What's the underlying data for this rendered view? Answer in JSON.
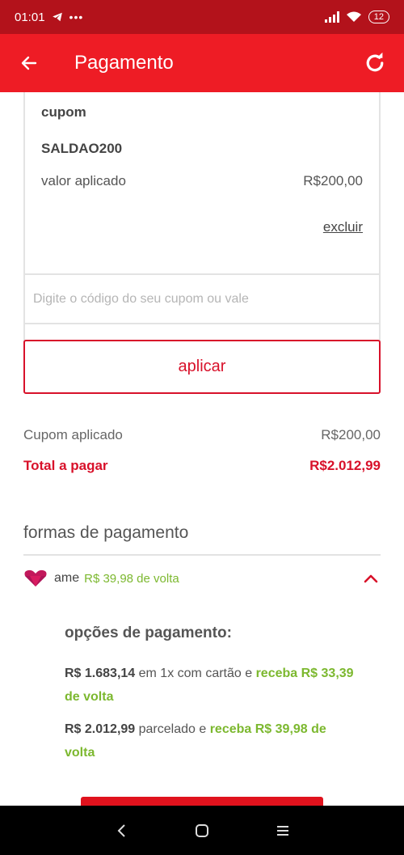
{
  "status_bar": {
    "time": "01:01",
    "battery": "12"
  },
  "app_bar": {
    "title": "Pagamento"
  },
  "coupon_card": {
    "label": "cupom",
    "code": "SALDAO200",
    "applied_label": "valor aplicado",
    "applied_value": "R$200,00",
    "remove_label": "excluir"
  },
  "coupon_input": {
    "placeholder": "Digite o código do seu cupom ou vale",
    "value": ""
  },
  "apply_button": {
    "label": "aplicar"
  },
  "summary": {
    "coupon_label": "Cupom aplicado",
    "coupon_value": "R$200,00",
    "total_label": "Total a pagar",
    "total_value": "R$2.012,99"
  },
  "payment": {
    "section_title": "formas de pagamento",
    "method": {
      "name": "ame",
      "cashback": "R$ 39,98 de volta",
      "icon": "ame-heart-icon"
    },
    "options_title": "opções de pagamento:",
    "options": [
      {
        "price": "R$ 1.683,14",
        "text": " em 1x com cartão e ",
        "cashback": "receba R$ 33,39 de volta"
      },
      {
        "price": "R$ 2.012,99",
        "text": " parcelado e ",
        "cashback": "receba R$ 39,98 de volta"
      }
    ]
  },
  "colors": {
    "status_bar": "#b3121b",
    "app_bar": "#ee1c25",
    "accent": "#d8112a",
    "cashback": "#7cb82f"
  },
  "icons": {
    "back": "arrow-left-icon",
    "refresh": "refresh-icon",
    "chevron": "chevron-up-icon"
  }
}
